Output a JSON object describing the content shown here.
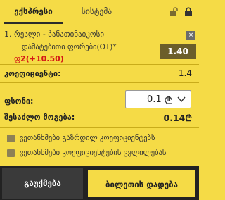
{
  "tabs": [
    {
      "label": "ექსპრესი",
      "active": true
    },
    {
      "label": "სისტემა",
      "active": false
    }
  ],
  "bet": {
    "title": "1. რეალი - პანათინაიკოსი",
    "market": "დამატებითი ფორები(OT)*",
    "outcome_prefix": "ფ",
    "outcome_value": "2(+10.50)",
    "odds": "1.40",
    "close": "×"
  },
  "coefficient": {
    "label": "კოეფიციენტი:",
    "value": "1.4"
  },
  "stake": {
    "label": "ფსონი:",
    "value": "0.1"
  },
  "possible_win": {
    "label": "შესაძლო მოგება:",
    "value": "0.14₾"
  },
  "checkboxes": [
    {
      "label": "ვეთანხმები გაზრდილ კოეფიციენტებს",
      "checked": false
    },
    {
      "label": "ვეთანხმები კოეფიციენტების ცვლილებას",
      "checked": false
    }
  ],
  "buttons": {
    "cancel": "გაუქმება",
    "place": "ბილეთის დადება"
  },
  "colors": {
    "background": "#f5db46",
    "odds_box": "#6b5e2a",
    "cancel_button": "#3a3a3a",
    "outcome": "#d41616"
  },
  "icons": [
    "unlock-icon",
    "lock-icon",
    "close-icon",
    "lari-icon",
    "chevron-down-icon"
  ]
}
